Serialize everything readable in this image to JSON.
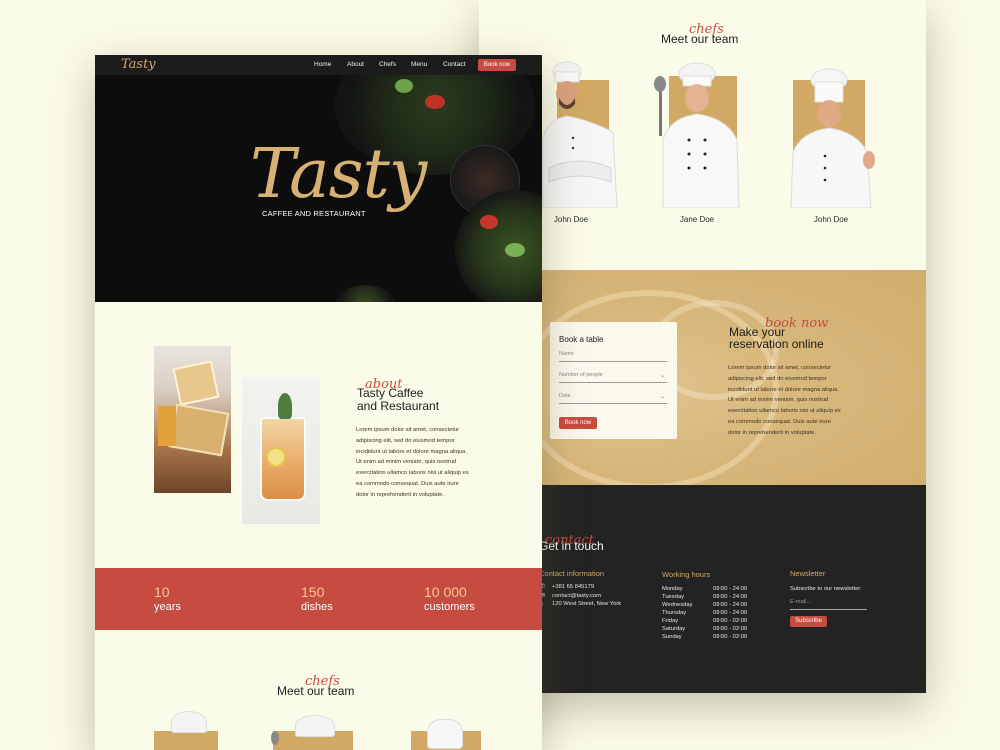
{
  "back": {
    "team": {
      "script": "chefs",
      "title": "Meet our team",
      "chefs": [
        {
          "name": "John Doe"
        },
        {
          "name": "Jane Doe"
        },
        {
          "name": "John Doe"
        }
      ]
    },
    "booking": {
      "script": "book now",
      "title_line1": "Make your",
      "title_line2": "reservation online",
      "card_title": "Book a table",
      "name_placeholder": "Name",
      "people_placeholder": "Number of people",
      "date_placeholder": "Date",
      "button": "Book now",
      "paragraph": [
        "Lorem ipsum dolor sit amet, consectetur",
        "adipiscing elit, sed do eiusmod tempor",
        "incididunt ut labore et dolore magna aliqua.",
        "Ut enim ad minim veniam, quis nostrud",
        "exercitation ullamco laboris nisi ut aliquip ex",
        "ea commodo consequat. Duis aute irure",
        "dolor in reprehenderit in voluptate."
      ]
    },
    "contact": {
      "script": "contact",
      "title": "Get in touch",
      "info_head": "Contact information",
      "phone": "+381 65 845179",
      "email": "contact@tasty.com",
      "address": "120 West Street, New York",
      "hours_head": "Working hours",
      "hours": [
        {
          "day": "Monday",
          "time": "09:00 - 24:00"
        },
        {
          "day": "Tuesday",
          "time": "09:00 - 24:00"
        },
        {
          "day": "Wednesday",
          "time": "09:00 - 24:00"
        },
        {
          "day": "Thursday",
          "time": "09:00 - 24:00"
        },
        {
          "day": "Friday",
          "time": "09:00 - 02:00"
        },
        {
          "day": "Saturday",
          "time": "09:00 - 02:00"
        },
        {
          "day": "Sunday",
          "time": "09:00 - 02:00"
        }
      ],
      "news_head": "Newsletter",
      "news_text": "Subscribe to our newsletter:",
      "email_placeholder": "E-mail...",
      "subscribe": "Subscribe"
    }
  },
  "front": {
    "logo": "Tasty",
    "nav": [
      "Home",
      "About",
      "Chefs",
      "Menu",
      "Contact"
    ],
    "nav_button": "Book now",
    "hero_title": "Tasty",
    "hero_subtitle": "CAFFEE AND RESTAURANT",
    "about": {
      "script": "about",
      "title_line1": "Tasty Caffee",
      "title_line2": "and Restaurant",
      "paragraph": [
        "Lorem ipsum dolor sit amet, consectetur",
        "adipiscing elit, sed do eiusmod tempor",
        "incididunt ut labore et dolore magna aliqua.",
        "Ut enim ad minim veniam, quis nostrud",
        "exercitation ullamco laboris nisi ut aliquip ex",
        "ea commodo consequat. Duis aute irure",
        "dolor in reprehenderit in voluptate."
      ]
    },
    "stats": [
      {
        "num": "10",
        "label": "years"
      },
      {
        "num": "150",
        "label": "dishes"
      },
      {
        "num": "10 000",
        "label": "customers"
      }
    ],
    "team": {
      "script": "chefs",
      "title": "Meet our team"
    }
  },
  "colors": {
    "accent": "#c64b40",
    "gold": "#d2a964",
    "cream": "#fbfbe9",
    "dark": "#1c1c1c"
  }
}
